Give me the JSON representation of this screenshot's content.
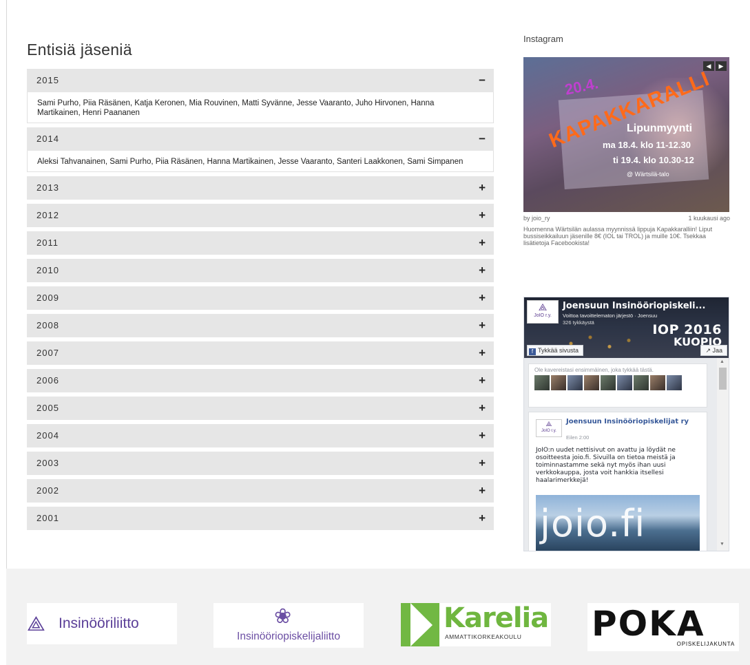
{
  "main": {
    "title": "Entisiä jäseniä",
    "items": [
      {
        "year": "2015",
        "toggle": "−",
        "expanded": true,
        "members": "Sami Purho, Piia Räsänen, Katja Keronen, Mia Rouvinen, Matti Syvänne, Jesse Vaaranto, Juho Hirvonen, Hanna Martikainen, Henri Paananen"
      },
      {
        "year": "2014",
        "toggle": "−",
        "expanded": true,
        "members": "Aleksi Tahvanainen, Sami Purho, Piia Räsänen, Hanna Martikainen, Jesse Vaaranto, Santeri Laakkonen, Sami Simpanen"
      },
      {
        "year": "2013",
        "toggle": "+",
        "expanded": false,
        "members": ""
      },
      {
        "year": "2012",
        "toggle": "+",
        "expanded": false,
        "members": ""
      },
      {
        "year": "2011",
        "toggle": "+",
        "expanded": false,
        "members": ""
      },
      {
        "year": "2010",
        "toggle": "+",
        "expanded": false,
        "members": ""
      },
      {
        "year": "2009",
        "toggle": "+",
        "expanded": false,
        "members": ""
      },
      {
        "year": "2008",
        "toggle": "+",
        "expanded": false,
        "members": ""
      },
      {
        "year": "2007",
        "toggle": "+",
        "expanded": false,
        "members": ""
      },
      {
        "year": "2006",
        "toggle": "+",
        "expanded": false,
        "members": ""
      },
      {
        "year": "2005",
        "toggle": "+",
        "expanded": false,
        "members": ""
      },
      {
        "year": "2004",
        "toggle": "+",
        "expanded": false,
        "members": ""
      },
      {
        "year": "2003",
        "toggle": "+",
        "expanded": false,
        "members": ""
      },
      {
        "year": "2002",
        "toggle": "+",
        "expanded": false,
        "members": ""
      },
      {
        "year": "2001",
        "toggle": "+",
        "expanded": false,
        "members": ""
      }
    ]
  },
  "instagram": {
    "label": "Instagram",
    "nav_prev": "◀",
    "nav_next": "▶",
    "poster": {
      "date": "20.4.",
      "title": "KAPAKKARALLI",
      "line1": "Lipunmyynti",
      "line2": "ma 18.4. klo 11-12.30",
      "line3": "ti 19.4. klo 10.30-12",
      "line4": "@ Wärtsilä-talo"
    },
    "user": "by joio_ry",
    "ago": "1 kuukausi ago",
    "caption": "Huomenna Wärtsilän aulassa myynnissä lippuja Kapakkaralliin! Liput bussiseikkailuun jäsenille 8€ (IOL tai TROL) ja muille 10€. Tsekkaa lisätietoja Facebookista!"
  },
  "facebook": {
    "page_name": "Joensuun Insinööriopiskeli...",
    "page_sub": "Voittoa tavoittelematon järjestö · Joensuu",
    "page_likes": "326 tykkäystä",
    "cover_line1": "IOP 2016",
    "cover_line2": "KUOPIO",
    "like_button": "Tykkää sivusta",
    "like_icon": "f",
    "share_button": "↗ Jaa",
    "friends_prompt": "Ole kavereistasi ensimmäinen, joka tykkää tästä.",
    "logo_text": "JoIO r.y.",
    "post_author": "Joensuun Insinööriopiskelijat ry",
    "post_time": "Eilen 2:00",
    "post_text": "JoIO:n uudet nettisivut on avattu ja löydät ne osoitteesta joio.fi. Sivuilla on tietoa meistä ja toiminnastamme sekä nyt myös ihan uusi verkkokauppa, josta voit hankkia itsellesi haalarimerkkejä!",
    "post_image_text": "joio.fi"
  },
  "footer": {
    "logos": [
      {
        "name": "Insinööriliitto",
        "icon": "insinooriliitto-logo-icon"
      },
      {
        "name": "Insinööriopiskelijaliitto",
        "icon": "iopl-logo-icon"
      },
      {
        "name": "Karelia",
        "sub": "AMMATTIKORKEAKOULU",
        "icon": "karelia-logo-icon"
      },
      {
        "name": "POKA",
        "sub": "OPISKELIJAKUNTA",
        "icon": "poka-logo-icon"
      }
    ],
    "colors": {
      "iol_purple": "#5b3f98",
      "karelia_green": "#6fb63f",
      "poka_black": "#111111"
    }
  }
}
